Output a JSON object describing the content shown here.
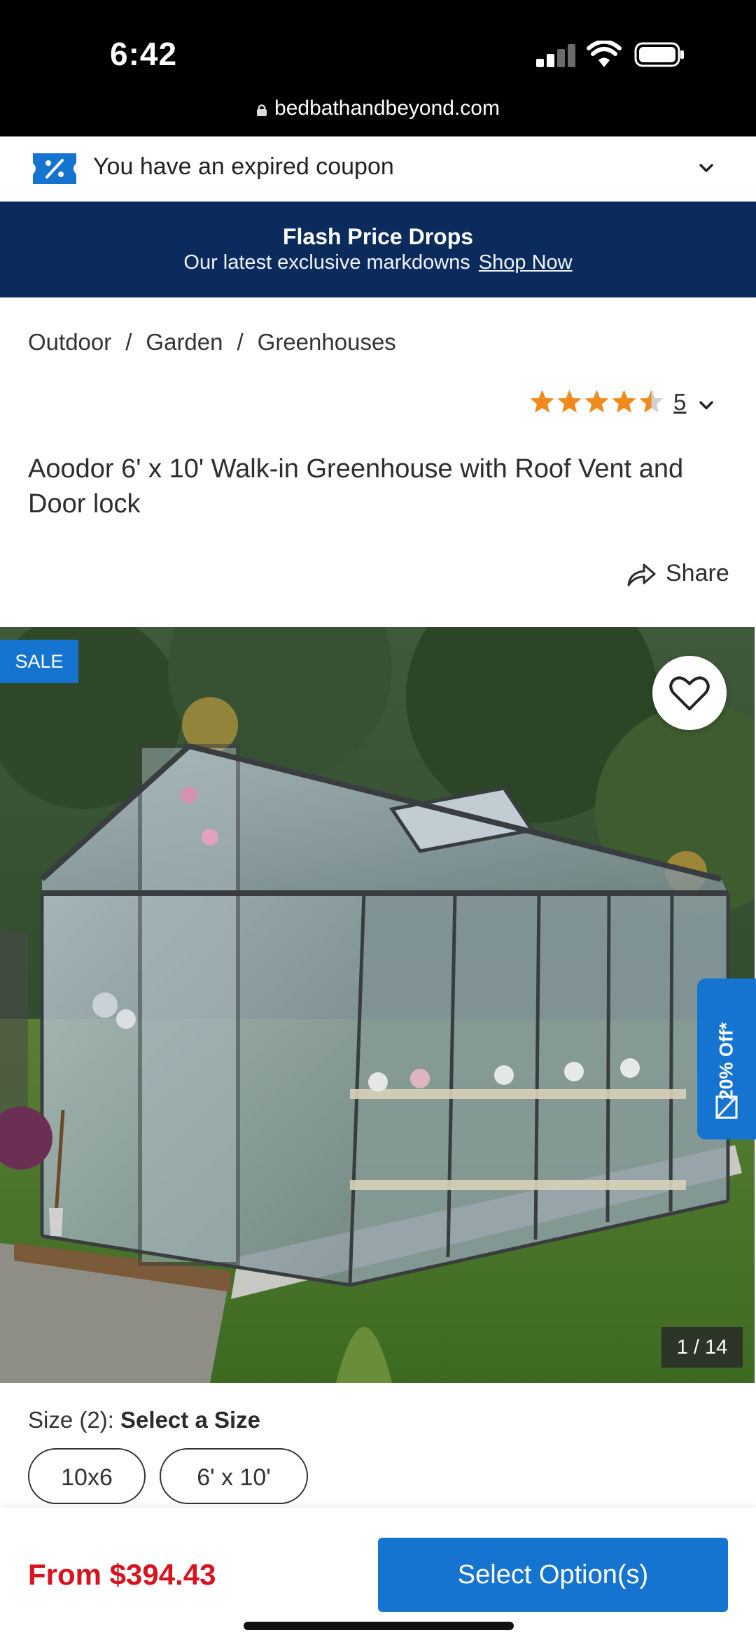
{
  "status_bar": {
    "time": "6:42",
    "url": "bedbathandbeyond.com"
  },
  "coupon": {
    "text": "You have an expired coupon",
    "icon": "coupon-percent-icon"
  },
  "flash": {
    "title": "Flash Price Drops",
    "subtitle": "Our latest exclusive markdowns",
    "link": "Shop Now"
  },
  "breadcrumb": [
    "Outdoor",
    "Garden",
    "Greenhouses"
  ],
  "breadcrumb_separator": "/",
  "rating": {
    "stars": 4.5,
    "max": 5,
    "count": "5"
  },
  "product": {
    "title": "Aoodor 6' x 10' Walk-in Greenhouse with Roof Vent and Door lock"
  },
  "share": {
    "label": "Share"
  },
  "gallery": {
    "sale_badge": "SALE",
    "promo": "20% Off*",
    "counter": "1 / 14"
  },
  "size": {
    "label": "Size (2):",
    "prompt": "Select a Size",
    "options": [
      "10x6",
      "6' x 10'"
    ]
  },
  "footer": {
    "price": "From $394.43",
    "cta": "Select Option(s)"
  },
  "colors": {
    "accent": "#1674d1",
    "banner": "#0a2b5c",
    "price": "#d6141f",
    "star": "#f08a1c"
  }
}
